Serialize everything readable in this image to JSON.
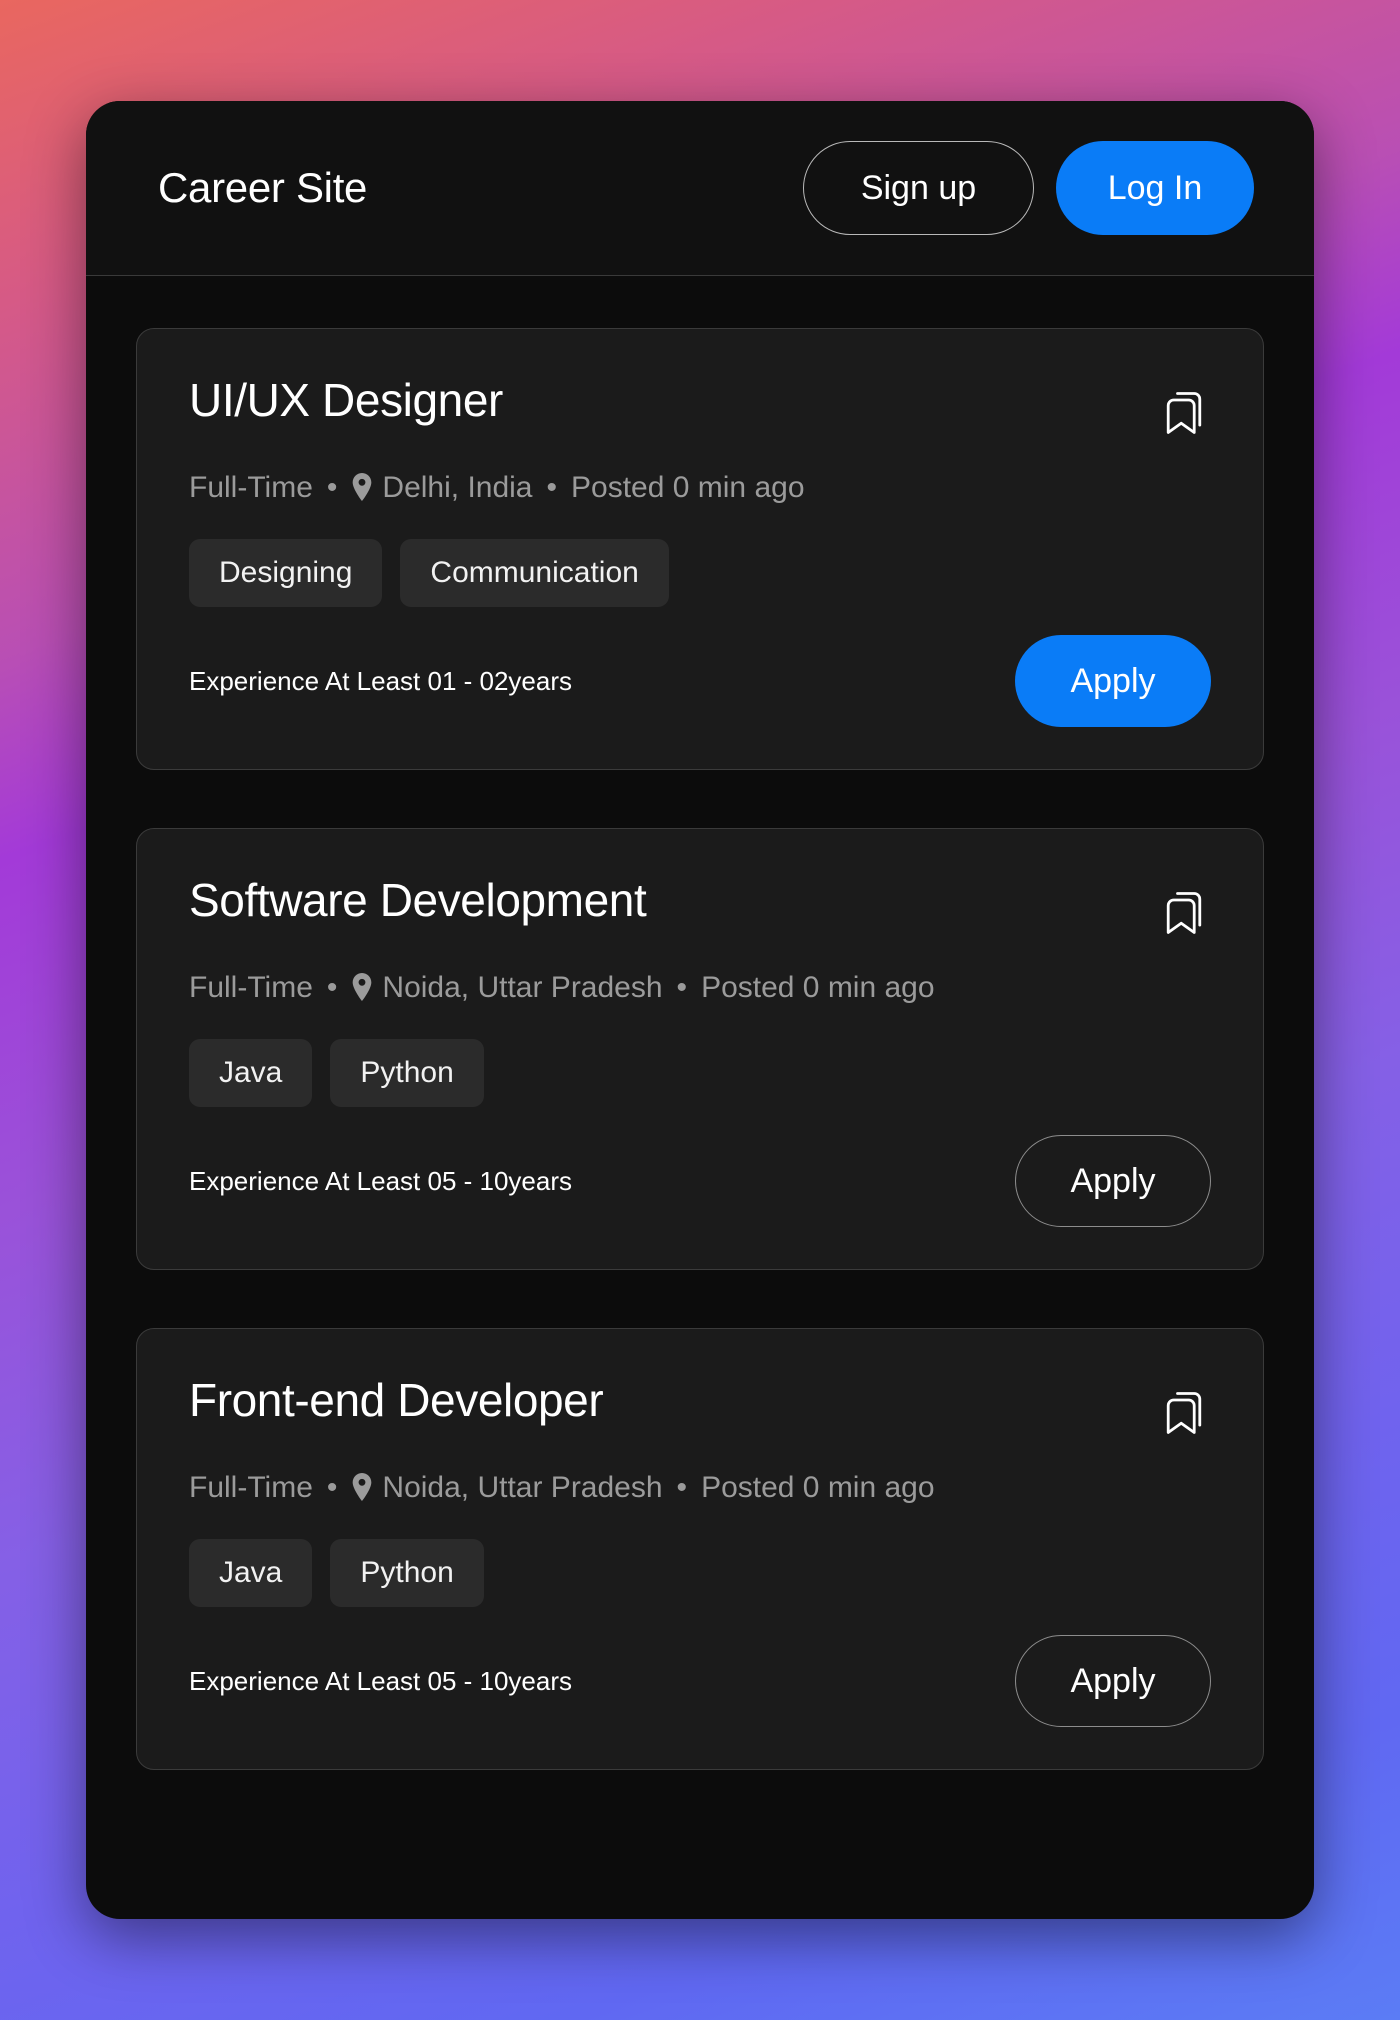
{
  "header": {
    "brand": "Career Site",
    "signup_label": "Sign up",
    "login_label": "Log In",
    "login_color": "#0a7cf7"
  },
  "icons": {
    "bookmark": "bookmark-icon",
    "location_pin": "location-pin-icon"
  },
  "jobs": [
    {
      "title": "UI/UX Designer",
      "employment_type": "Full-Time",
      "location": "Delhi, India",
      "posted": "Posted 0 min ago",
      "tags": [
        "Designing",
        "Communication"
      ],
      "experience": "Experience At Least 01 - 02years",
      "apply_label": "Apply",
      "apply_style": "filled"
    },
    {
      "title": "Software Development",
      "employment_type": "Full-Time",
      "location": "Noida, Uttar Pradesh",
      "posted": "Posted 0 min ago",
      "tags": [
        "Java",
        "Python"
      ],
      "experience": "Experience At Least 05 - 10years",
      "apply_label": "Apply",
      "apply_style": "outline"
    },
    {
      "title": "Front-end Developer",
      "employment_type": "Full-Time",
      "location": "Noida, Uttar Pradesh",
      "posted": "Posted 0 min ago",
      "tags": [
        "Java",
        "Python"
      ],
      "experience": "Experience At Least 05 - 10years",
      "apply_label": "Apply",
      "apply_style": "outline"
    }
  ],
  "separator": "•"
}
